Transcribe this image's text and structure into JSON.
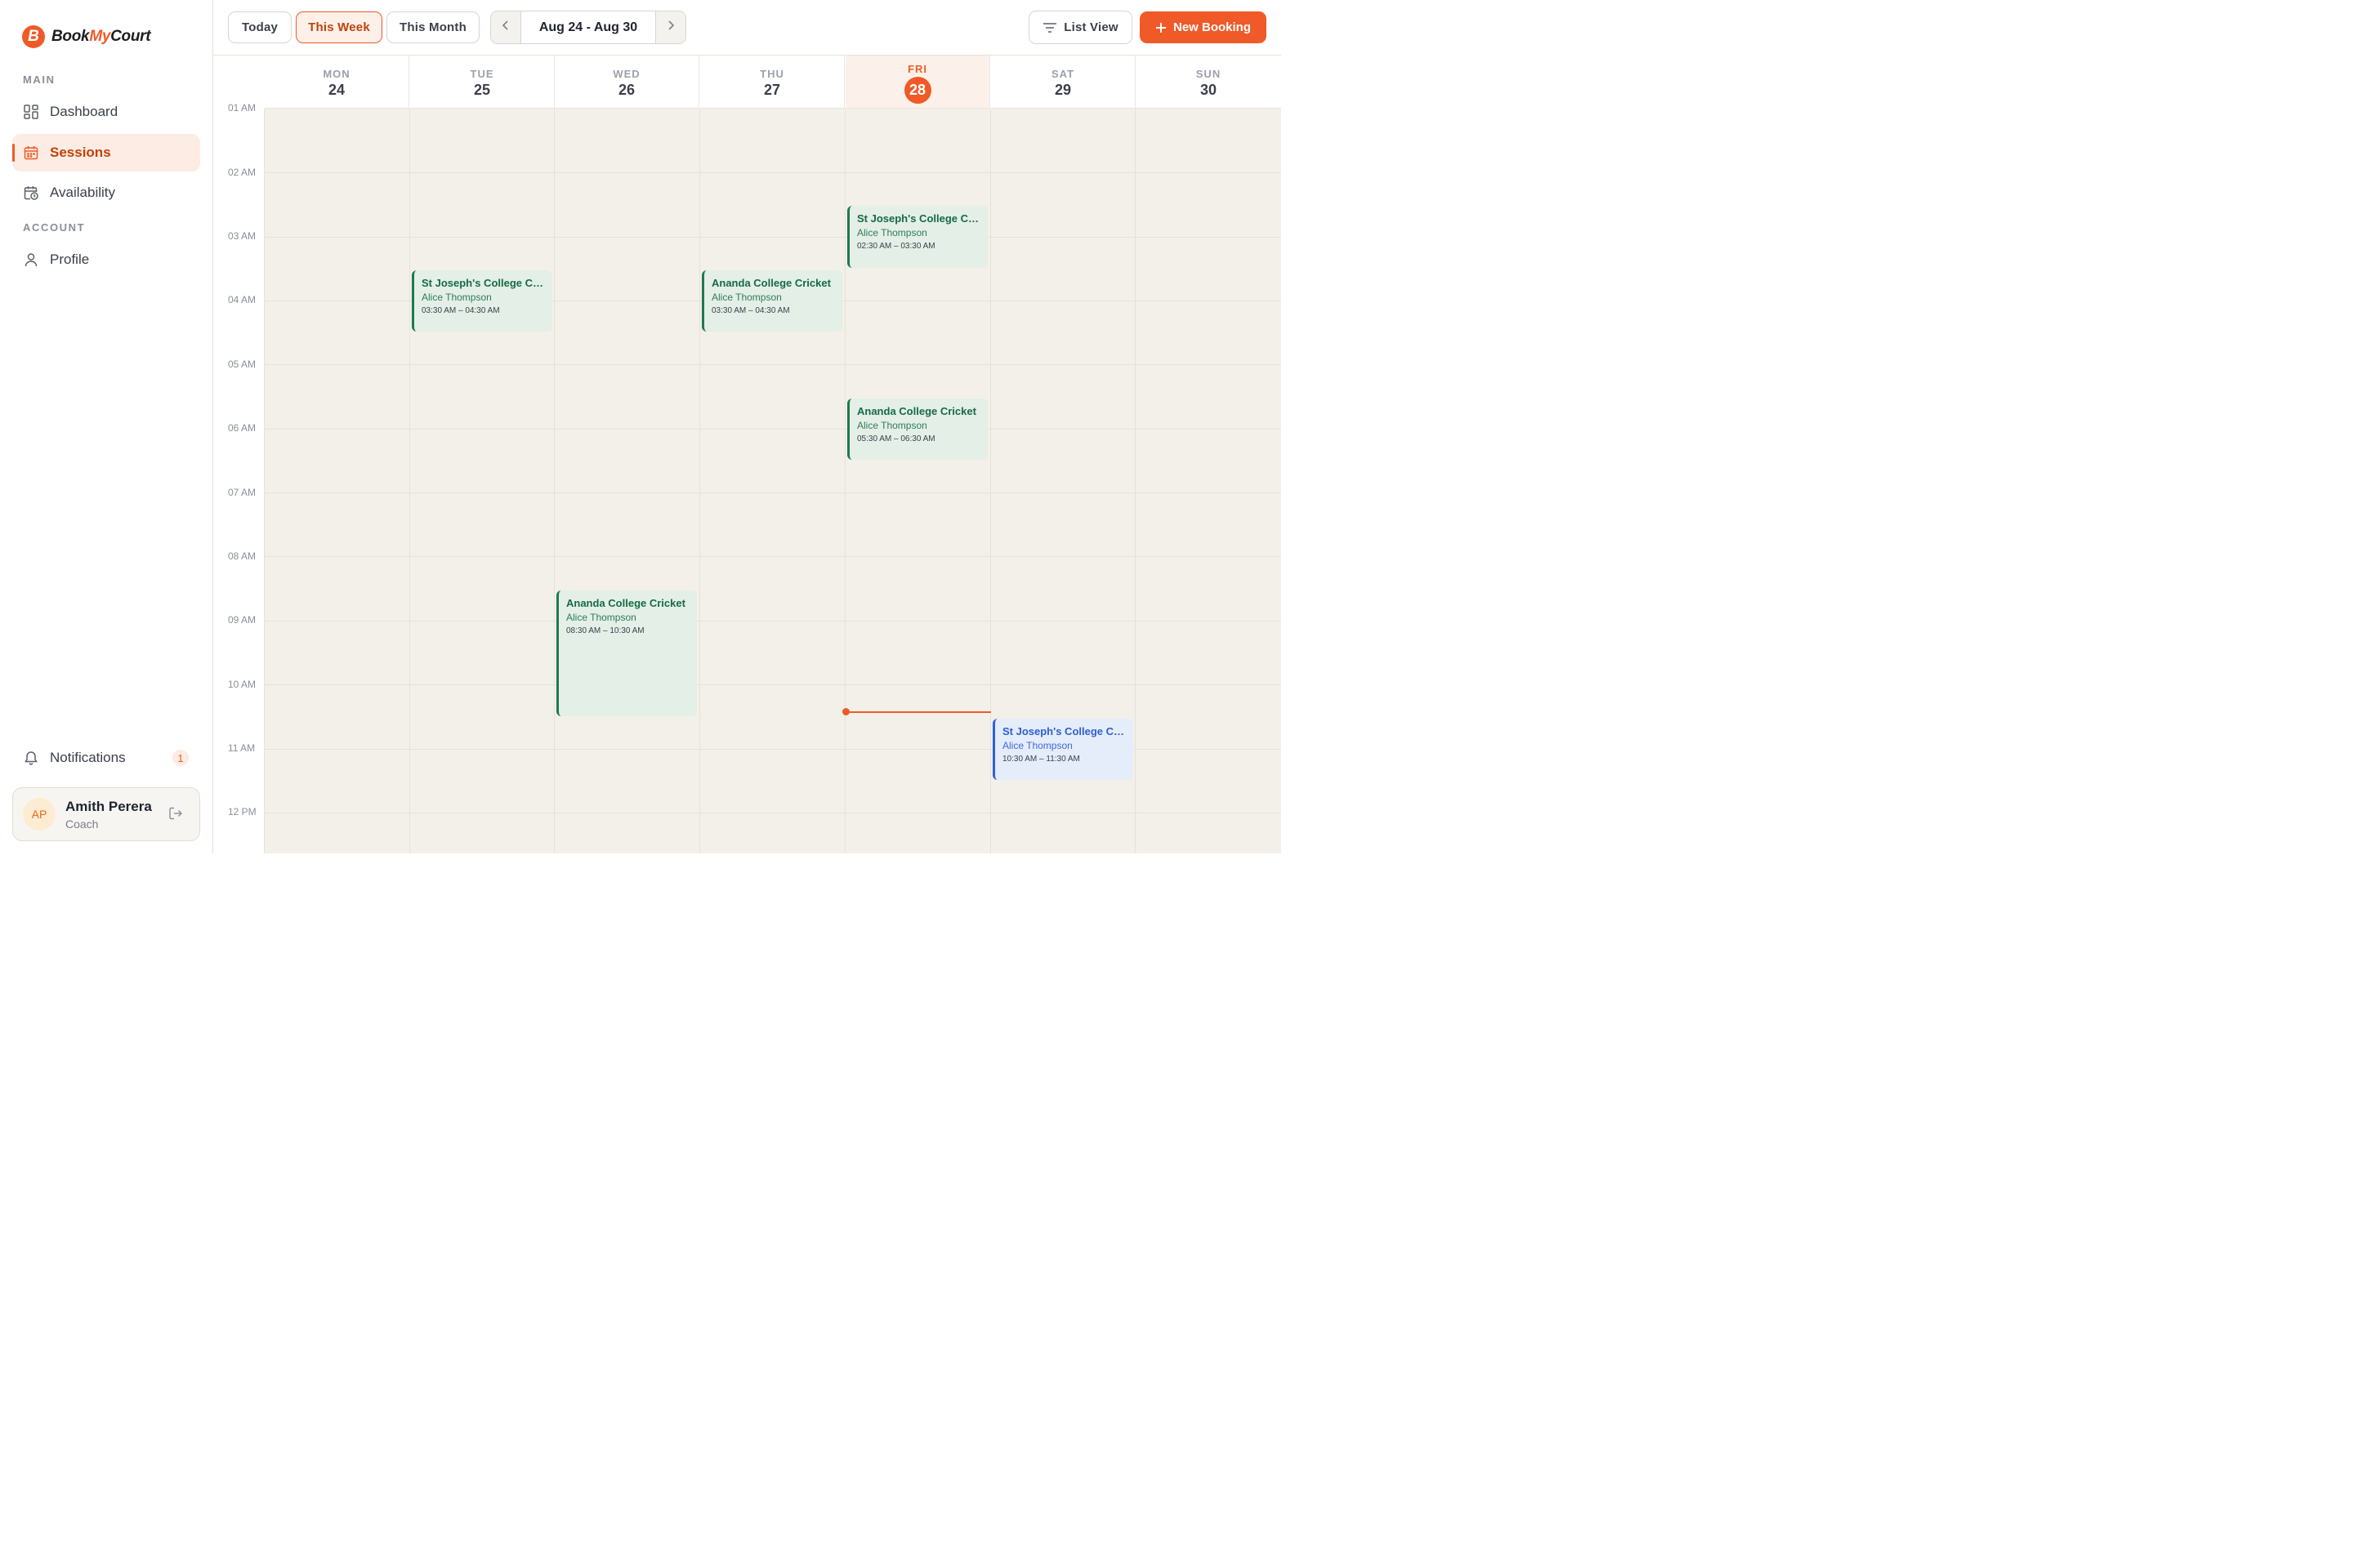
{
  "app": {
    "logo_letter": "B",
    "name_part1": "Book",
    "name_part2": "My",
    "name_part3": "Court",
    "brand_color": "#ef5a28"
  },
  "sidebar": {
    "section_main": "MAIN",
    "section_account": "ACCOUNT",
    "items": [
      {
        "label": "Dashboard",
        "icon": "grid-icon"
      },
      {
        "label": "Sessions",
        "icon": "calendar-icon",
        "active": true
      },
      {
        "label": "Availability",
        "icon": "calendar-clock-icon"
      },
      {
        "label": "Profile",
        "icon": "user-icon"
      }
    ],
    "notifications": {
      "label": "Notifications",
      "count": "1",
      "icon": "bell-icon"
    },
    "user": {
      "initials": "AP",
      "name": "Amith Perera",
      "role": "Coach"
    }
  },
  "toolbar": {
    "today_label": "Today",
    "week_label": "This Week",
    "month_label": "This Month",
    "active_range": "This Week",
    "range_label": "Aug 24 - Aug 30",
    "list_view_label": "List View",
    "new_booking_label": "New Booking"
  },
  "calendar": {
    "days": [
      {
        "name": "MON",
        "num": "24"
      },
      {
        "name": "TUE",
        "num": "25"
      },
      {
        "name": "WED",
        "num": "26"
      },
      {
        "name": "THU",
        "num": "27"
      },
      {
        "name": "FRI",
        "num": "28",
        "today": true
      },
      {
        "name": "SAT",
        "num": "29"
      },
      {
        "name": "SUN",
        "num": "30"
      }
    ],
    "hours": [
      "01 AM",
      "02 AM",
      "03 AM",
      "04 AM",
      "05 AM",
      "06 AM",
      "07 AM",
      "08 AM",
      "09 AM",
      "10 AM",
      "11 AM",
      "12 PM"
    ],
    "events": [
      {
        "title": "St Joseph's College Cricket",
        "coach": "Alice Thompson",
        "time": "03:30 AM – 04:30 AM"
      },
      {
        "title": "Ananda College Cricket",
        "coach": "Alice Thompson",
        "time": "03:30 AM – 04:30 AM"
      },
      {
        "title": "St Joseph's College Cricket",
        "coach": "Alice Thompson",
        "time": "02:30 AM – 03:30 AM"
      },
      {
        "title": "Ananda College Cricket",
        "coach": "Alice Thompson",
        "time": "05:30 AM – 06:30 AM"
      },
      {
        "title": "Ananda College Cricket",
        "coach": "Alice Thompson",
        "time": "08:30 AM – 10:30 AM"
      },
      {
        "title": "St Joseph's College Cricket",
        "coach": "Alice Thompson",
        "time": "10:30 AM – 11:30 AM"
      }
    ],
    "event_colors": {
      "confirmed": "#1e7a4c",
      "upcoming": "#2f63d6"
    }
  }
}
